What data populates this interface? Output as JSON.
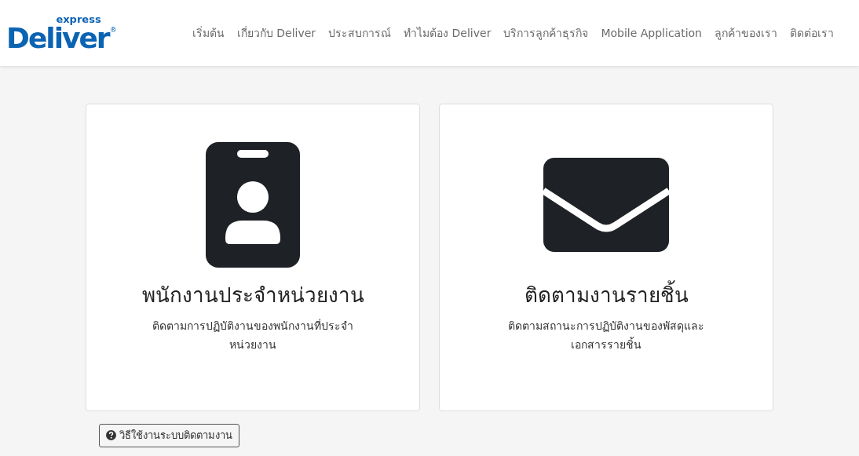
{
  "logo": {
    "name": "Deliver",
    "tagline": "express",
    "mark": "®"
  },
  "nav": [
    {
      "label": "เริ่มต้น"
    },
    {
      "label": "เกี่ยวกับ Deliver"
    },
    {
      "label": "ประสบการณ์"
    },
    {
      "label": "ทำไมต้อง Deliver"
    },
    {
      "label": "บริการลูกค้าธุรกิจ"
    },
    {
      "label": "Mobile Application"
    },
    {
      "label": "ลูกค้าของเรา"
    },
    {
      "label": "ติดต่อเรา"
    }
  ],
  "cards": [
    {
      "kind": "id-badge",
      "title": "พนักงานประจำหน่วยงาน",
      "description": "ติดตามการปฏิบัติงานของพนักงานที่ประจำหน่วยงาน"
    },
    {
      "kind": "envelope",
      "title": "ติดตามงานรายชิ้น",
      "description": "ติดตามสถานะการปฏิบัติงานของพัสดุและเอกสารรายชิ้น"
    }
  ],
  "help_button": {
    "label": "วิธีใช้งานระบบติดตามงาน"
  }
}
